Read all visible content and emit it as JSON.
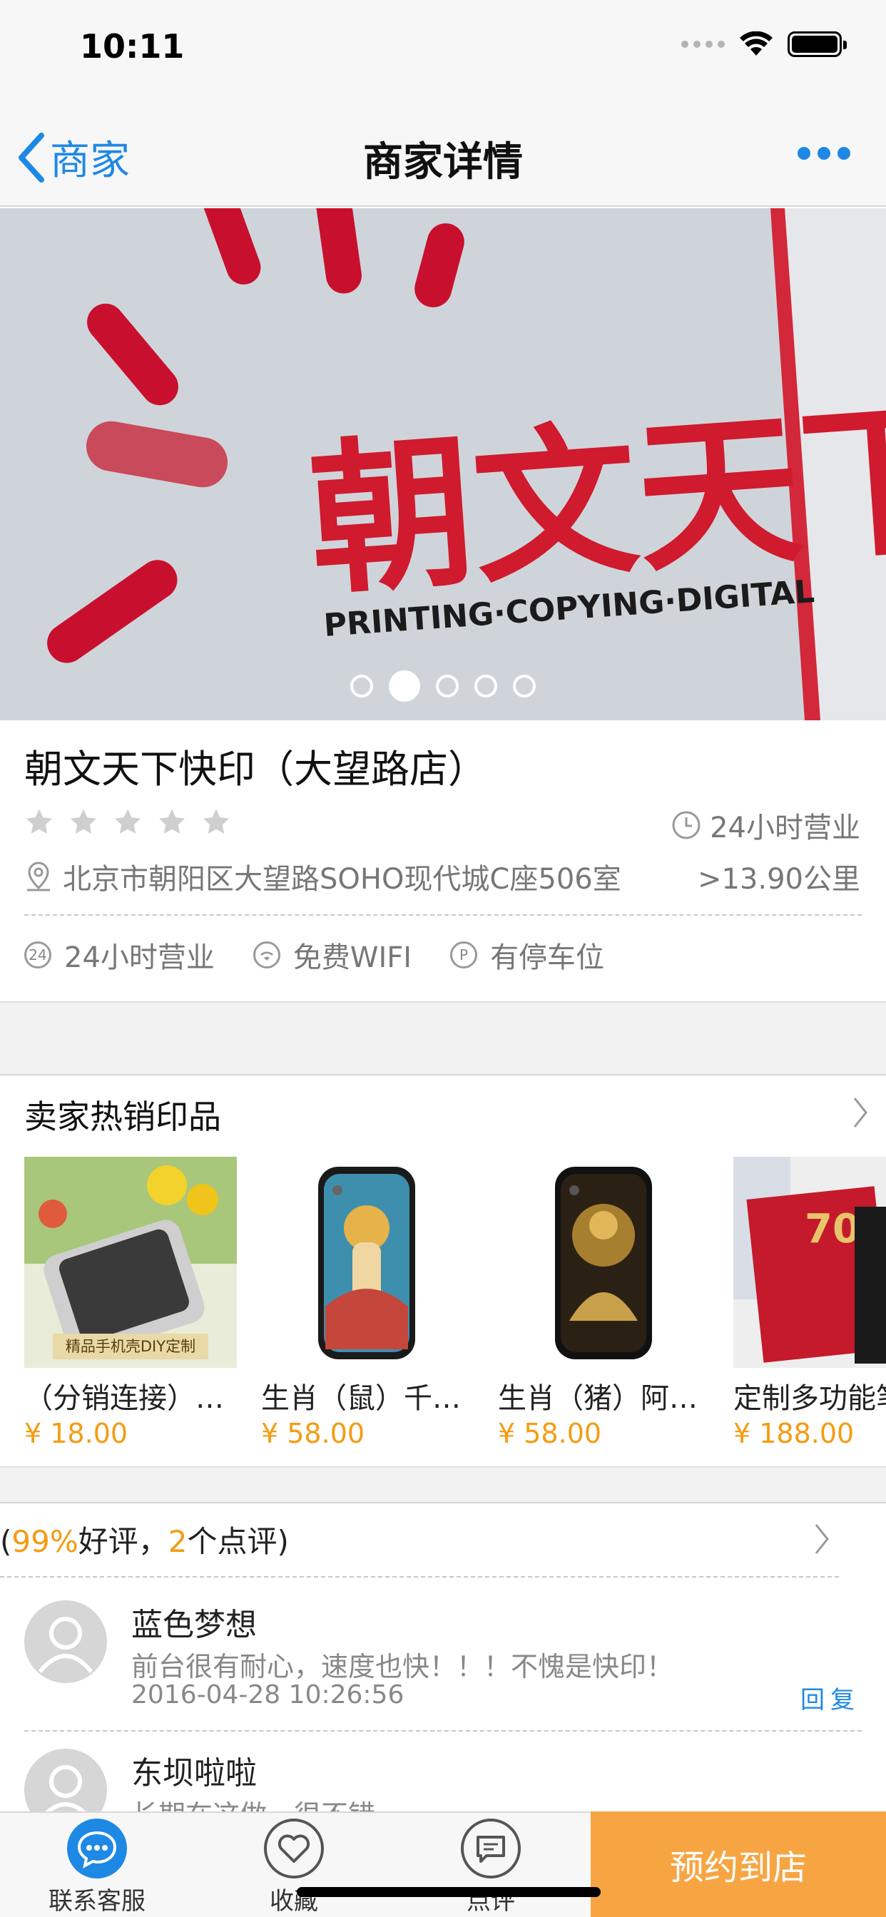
{
  "status_bar": {
    "time": "10:11"
  },
  "nav": {
    "back_label": "商家",
    "title": "商家详情"
  },
  "banner": {
    "page_count": 5,
    "active_index": 1
  },
  "shop": {
    "name": "朝文天下快印（大望路店）",
    "rating_stars": 0,
    "hours_badge": "24小时营业",
    "address": "北京市朝阳区大望路SOHO现代城C座506室",
    "distance": ">13.90公里",
    "features": [
      {
        "icon": "24-hour-icon",
        "glyph": "24",
        "label": "24小时营业"
      },
      {
        "icon": "wifi-icon",
        "glyph": "",
        "label": "免费WIFI"
      },
      {
        "icon": "parking-icon",
        "glyph": "P",
        "label": "有停车位"
      }
    ]
  },
  "hot_products": {
    "title": "卖家热销印品",
    "items": [
      {
        "name": "（分销连接）…",
        "price": "¥ 18.00",
        "image_caption": "精品手机壳DIY定制"
      },
      {
        "name": "生肖（鼠）千…",
        "price": "¥ 58.00",
        "image_caption": ""
      },
      {
        "name": "生肖（猪）阿…",
        "price": "¥ 58.00",
        "image_caption": ""
      },
      {
        "name": "定制多功能笔",
        "price": "¥ 188.00",
        "image_caption": ""
      }
    ]
  },
  "reviews": {
    "summary_open": "(",
    "good_rate": "99%",
    "good_text": "好评，",
    "count": "2",
    "count_text": "个点评)",
    "items": [
      {
        "user": "蓝色梦想",
        "text": "前台很有耐心，速度也快！！！不愧是快印！",
        "date": "2016-04-28 10:26:56",
        "reply_label": "回复"
      },
      {
        "user": "东坝啦啦",
        "text": "长期在这做，很不错",
        "date": "",
        "reply_label": ""
      }
    ]
  },
  "tabbar": {
    "service_label": "联系客服",
    "favorite_label": "收藏",
    "comment_label": "点评",
    "book_label": "预约到店"
  },
  "colors": {
    "accent_blue": "#1e88e5",
    "accent_orange": "#f39c12",
    "book_button": "#f7a543"
  }
}
